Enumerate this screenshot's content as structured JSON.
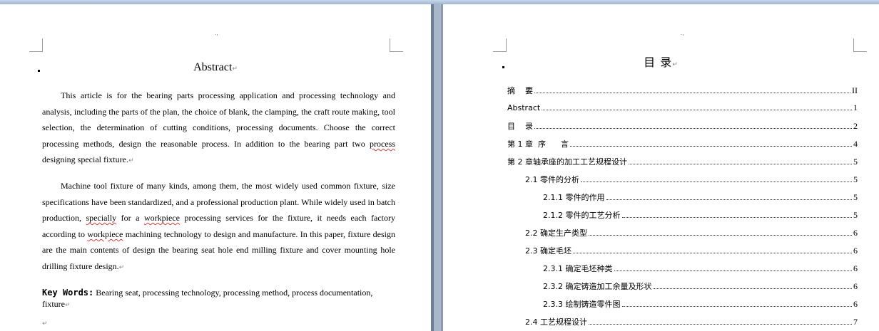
{
  "left_page": {
    "title": "Abstract",
    "paragraph_mark": "↵",
    "para1": {
      "t1": "This article is  for the bearing parts processing application and processing technology and analysis, including the parts of the plan, the choice of blank, the clamping, the craft route making, tool selection, the determination of cutting conditions, processing documents. Choose the correct processing methods, design the reasonable process. In addition to the bearing part two ",
      "w1": "process",
      "t2": " designing special fixture."
    },
    "para2": {
      "t1": "Machine tool fixture of many kinds, among them, the most widely used common fixture, size specifications have been standardized, and a professional production plant. While widely used in batch production, ",
      "w1": "specially",
      "t2": " for a ",
      "w2": "workpiece",
      "t3": " processing services for the fixture, it needs each factory according to ",
      "w3": "workpiece",
      "t4": " machining technology to design and manufacture. In this paper, fixture design are the main contents of design the bearing seat hole end milling fixture and cover mounting hole drilling fixture design."
    },
    "keywords_label": "Key Words:",
    "keywords_text": "Bearing seat, processing technology, processing method, process documentation, fixture"
  },
  "right_page": {
    "title": "目  录",
    "toc": [
      {
        "label": "摘    要",
        "page": "II"
      },
      {
        "label": "Abstract",
        "page": "1"
      },
      {
        "label": "目    录",
        "page": "2"
      },
      {
        "label": "第 1 章  序      言",
        "page": "4"
      },
      {
        "label": "第 2 章轴承座的加工工艺规程设计",
        "page": "5"
      },
      {
        "label": "2.1 零件的分析",
        "page": "5"
      },
      {
        "label": "2.1.1 零件的作用",
        "page": "5"
      },
      {
        "label": "2.1.2 零件的工艺分析",
        "page": "5"
      },
      {
        "label": "2.2 确定生产类型",
        "page": "6"
      },
      {
        "label": "2.3 确定毛坯",
        "page": "6"
      },
      {
        "label": "2.3.1 确定毛坯种类",
        "page": "6"
      },
      {
        "label": "2.3.2 确定铸造加工余量及形状",
        "page": "6"
      },
      {
        "label": "2.3.3 绘制铸造零件图",
        "page": "6"
      },
      {
        "label": "2.4 工艺规程设计",
        "page": "7"
      }
    ]
  }
}
